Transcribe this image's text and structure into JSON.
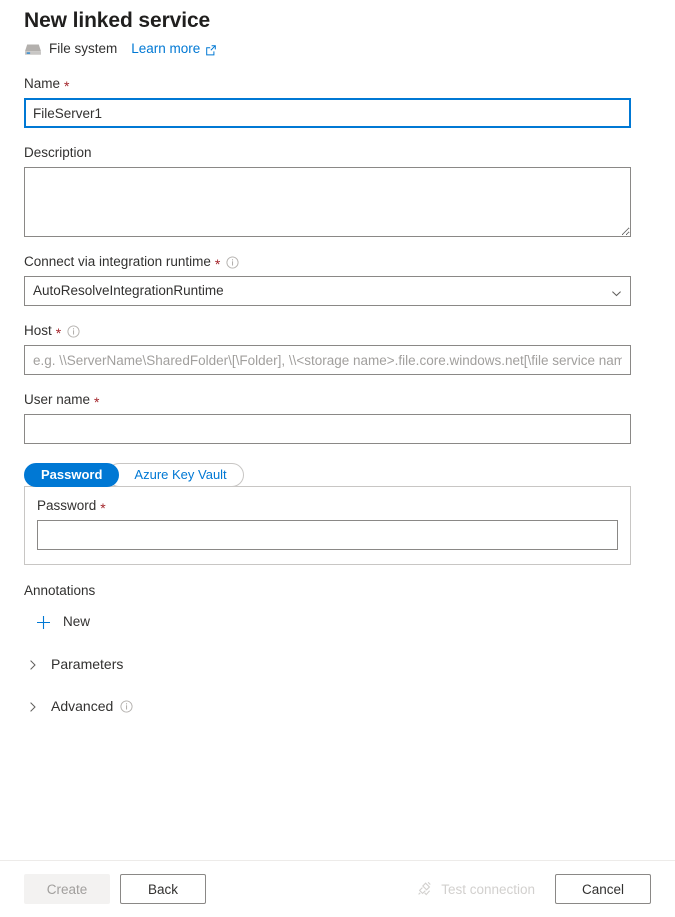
{
  "header": {
    "title": "New linked service",
    "service_type": "File system",
    "service_icon": "file-system-drive-icon",
    "learn_more": "Learn more",
    "learn_more_icon": "external-link-icon"
  },
  "form": {
    "name": {
      "label": "Name",
      "required": "*",
      "value": "FileServer1",
      "placeholder": ""
    },
    "description": {
      "label": "Description",
      "value": "",
      "placeholder": ""
    },
    "integration_runtime": {
      "label": "Connect via integration runtime",
      "required": "*",
      "info_icon": "info-icon",
      "selected": "AutoResolveIntegrationRuntime",
      "chevron_icon": "chevron-down-icon"
    },
    "host": {
      "label": "Host",
      "required": "*",
      "info_icon": "info-icon",
      "value": "",
      "placeholder": "e.g. \\\\ServerName\\SharedFolder\\[\\Folder], \\\\<storage name>.file.core.windows.net[\\file service name]"
    },
    "user_name": {
      "label": "User name",
      "required": "*",
      "value": "",
      "placeholder": ""
    },
    "auth": {
      "tabs": [
        {
          "label": "Password",
          "selected": true
        },
        {
          "label": "Azure Key Vault",
          "selected": false
        }
      ],
      "password": {
        "label": "Password",
        "required": "*",
        "value": "",
        "placeholder": ""
      }
    }
  },
  "annotations": {
    "label": "Annotations",
    "new_label": "New",
    "new_icon": "plus-icon"
  },
  "sections": [
    {
      "label": "Parameters",
      "icon": "chevron-right-icon",
      "expanded": false,
      "info": false
    },
    {
      "label": "Advanced",
      "icon": "chevron-right-icon",
      "expanded": false,
      "info": true
    }
  ],
  "footer": {
    "create": "Create",
    "back": "Back",
    "test_connection": "Test connection",
    "test_connection_icon": "plug-connection-icon",
    "cancel": "Cancel"
  },
  "colors": {
    "accent": "#0078d4",
    "required_red": "#a4262c",
    "text": "#323130",
    "border": "#8a8886",
    "disabled_text": "#a19f9d",
    "disabled_bg": "#f3f2f1"
  }
}
